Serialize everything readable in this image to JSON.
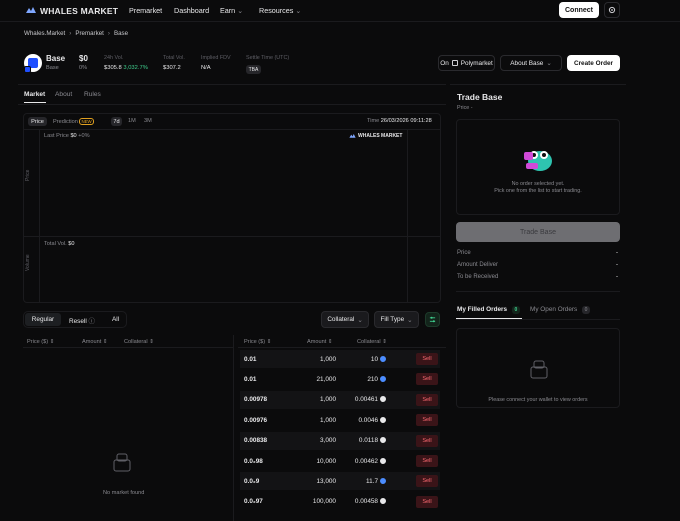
{
  "nav": {
    "brand": "WHALES MARKET",
    "items": [
      "Premarket",
      "Dashboard",
      "Earn",
      "Resources"
    ],
    "connect_label": "Connect"
  },
  "breadcrumb": [
    "Whales.Market",
    "Premarket",
    "Base"
  ],
  "token": {
    "name": "Base",
    "sub": "Base",
    "price": "$0",
    "change": "0%",
    "stats": [
      {
        "label": "24h Vol.",
        "value": "$305.8",
        "extra": "3,032.7%"
      },
      {
        "label": "Total Vol.",
        "value": "$307.2",
        "extra": ""
      },
      {
        "label": "Implied FDV",
        "value": "N/A",
        "extra": ""
      },
      {
        "label": "Settle Time (UTC)",
        "value": "TBA",
        "extra": ""
      }
    ],
    "on_label": "On",
    "polymarket_label": "Polymarket",
    "about_label": "About Base",
    "create_order_label": "Create Order"
  },
  "tabs": [
    "Market",
    "About",
    "Rules"
  ],
  "chart": {
    "modes": [
      "Price",
      "Prediction"
    ],
    "new_badge": "NEW",
    "ranges": [
      "7d",
      "1M",
      "3M"
    ],
    "time_label": "Time",
    "time_value": "26/03/2026 09:11:28",
    "last_price_label": "Last Price",
    "last_price_value": "$0",
    "last_price_change": "+0%",
    "price_axis": "Price",
    "volume_axis": "Volume",
    "total_vol_label": "Total Vol.",
    "total_vol_value": "$0",
    "watermark": "WHALES MARKET"
  },
  "filters": {
    "tabs": [
      "Regular",
      "Resell",
      "All"
    ],
    "collateral_label": "Collateral",
    "fill_type_label": "Fill Type"
  },
  "buy_table": {
    "headers": [
      "Price ($)",
      "Amount",
      "Collateral"
    ],
    "empty_text": "No market found"
  },
  "sell_table": {
    "headers": [
      "Price ($)",
      "Amount",
      "Collateral"
    ],
    "action_label": "Sell",
    "rows": [
      {
        "price": "0.01",
        "amount": "1,000",
        "collateral": "10",
        "coin": "#4c8dff"
      },
      {
        "price": "0.01",
        "amount": "21,000",
        "collateral": "210",
        "coin": "#4c8dff"
      },
      {
        "price": "0.00978",
        "amount": "1,000",
        "collateral": "0.00461",
        "coin": "#e8e8ea"
      },
      {
        "price": "0.00976",
        "amount": "1,000",
        "collateral": "0.0046",
        "coin": "#e8e8ea"
      },
      {
        "price": "0.00838",
        "amount": "3,000",
        "collateral": "0.0118",
        "coin": "#e8e8ea"
      },
      {
        "price": "0.0₂98",
        "amount": "10,000",
        "collateral": "0.00462",
        "coin": "#e8e8ea"
      },
      {
        "price": "0.0₂9",
        "amount": "13,000",
        "collateral": "11.7",
        "coin": "#4c8dff"
      },
      {
        "price": "0.0₂97",
        "amount": "100,000",
        "collateral": "0.00458",
        "coin": "#e8e8ea"
      }
    ]
  },
  "trade": {
    "title": "Trade Base",
    "price_label": "Price -",
    "empty_line1": "No order selected yet.",
    "empty_line2": "Pick one from the list to start trading.",
    "button_label": "Trade Base",
    "summary": [
      {
        "label": "Price",
        "value": "-"
      },
      {
        "label": "Amount Deliver",
        "value": "-"
      },
      {
        "label": "To be Received",
        "value": "-"
      }
    ]
  },
  "orders": {
    "filled_label": "My Filled Orders",
    "filled_count": "0",
    "open_label": "My Open Orders",
    "open_count": "0",
    "empty_text": "Please connect your wallet to view orders"
  },
  "colors": {
    "accent_green": "#3fcf8e",
    "sell_red": "#ff6b73",
    "brand_blue": "#1f4fff"
  }
}
